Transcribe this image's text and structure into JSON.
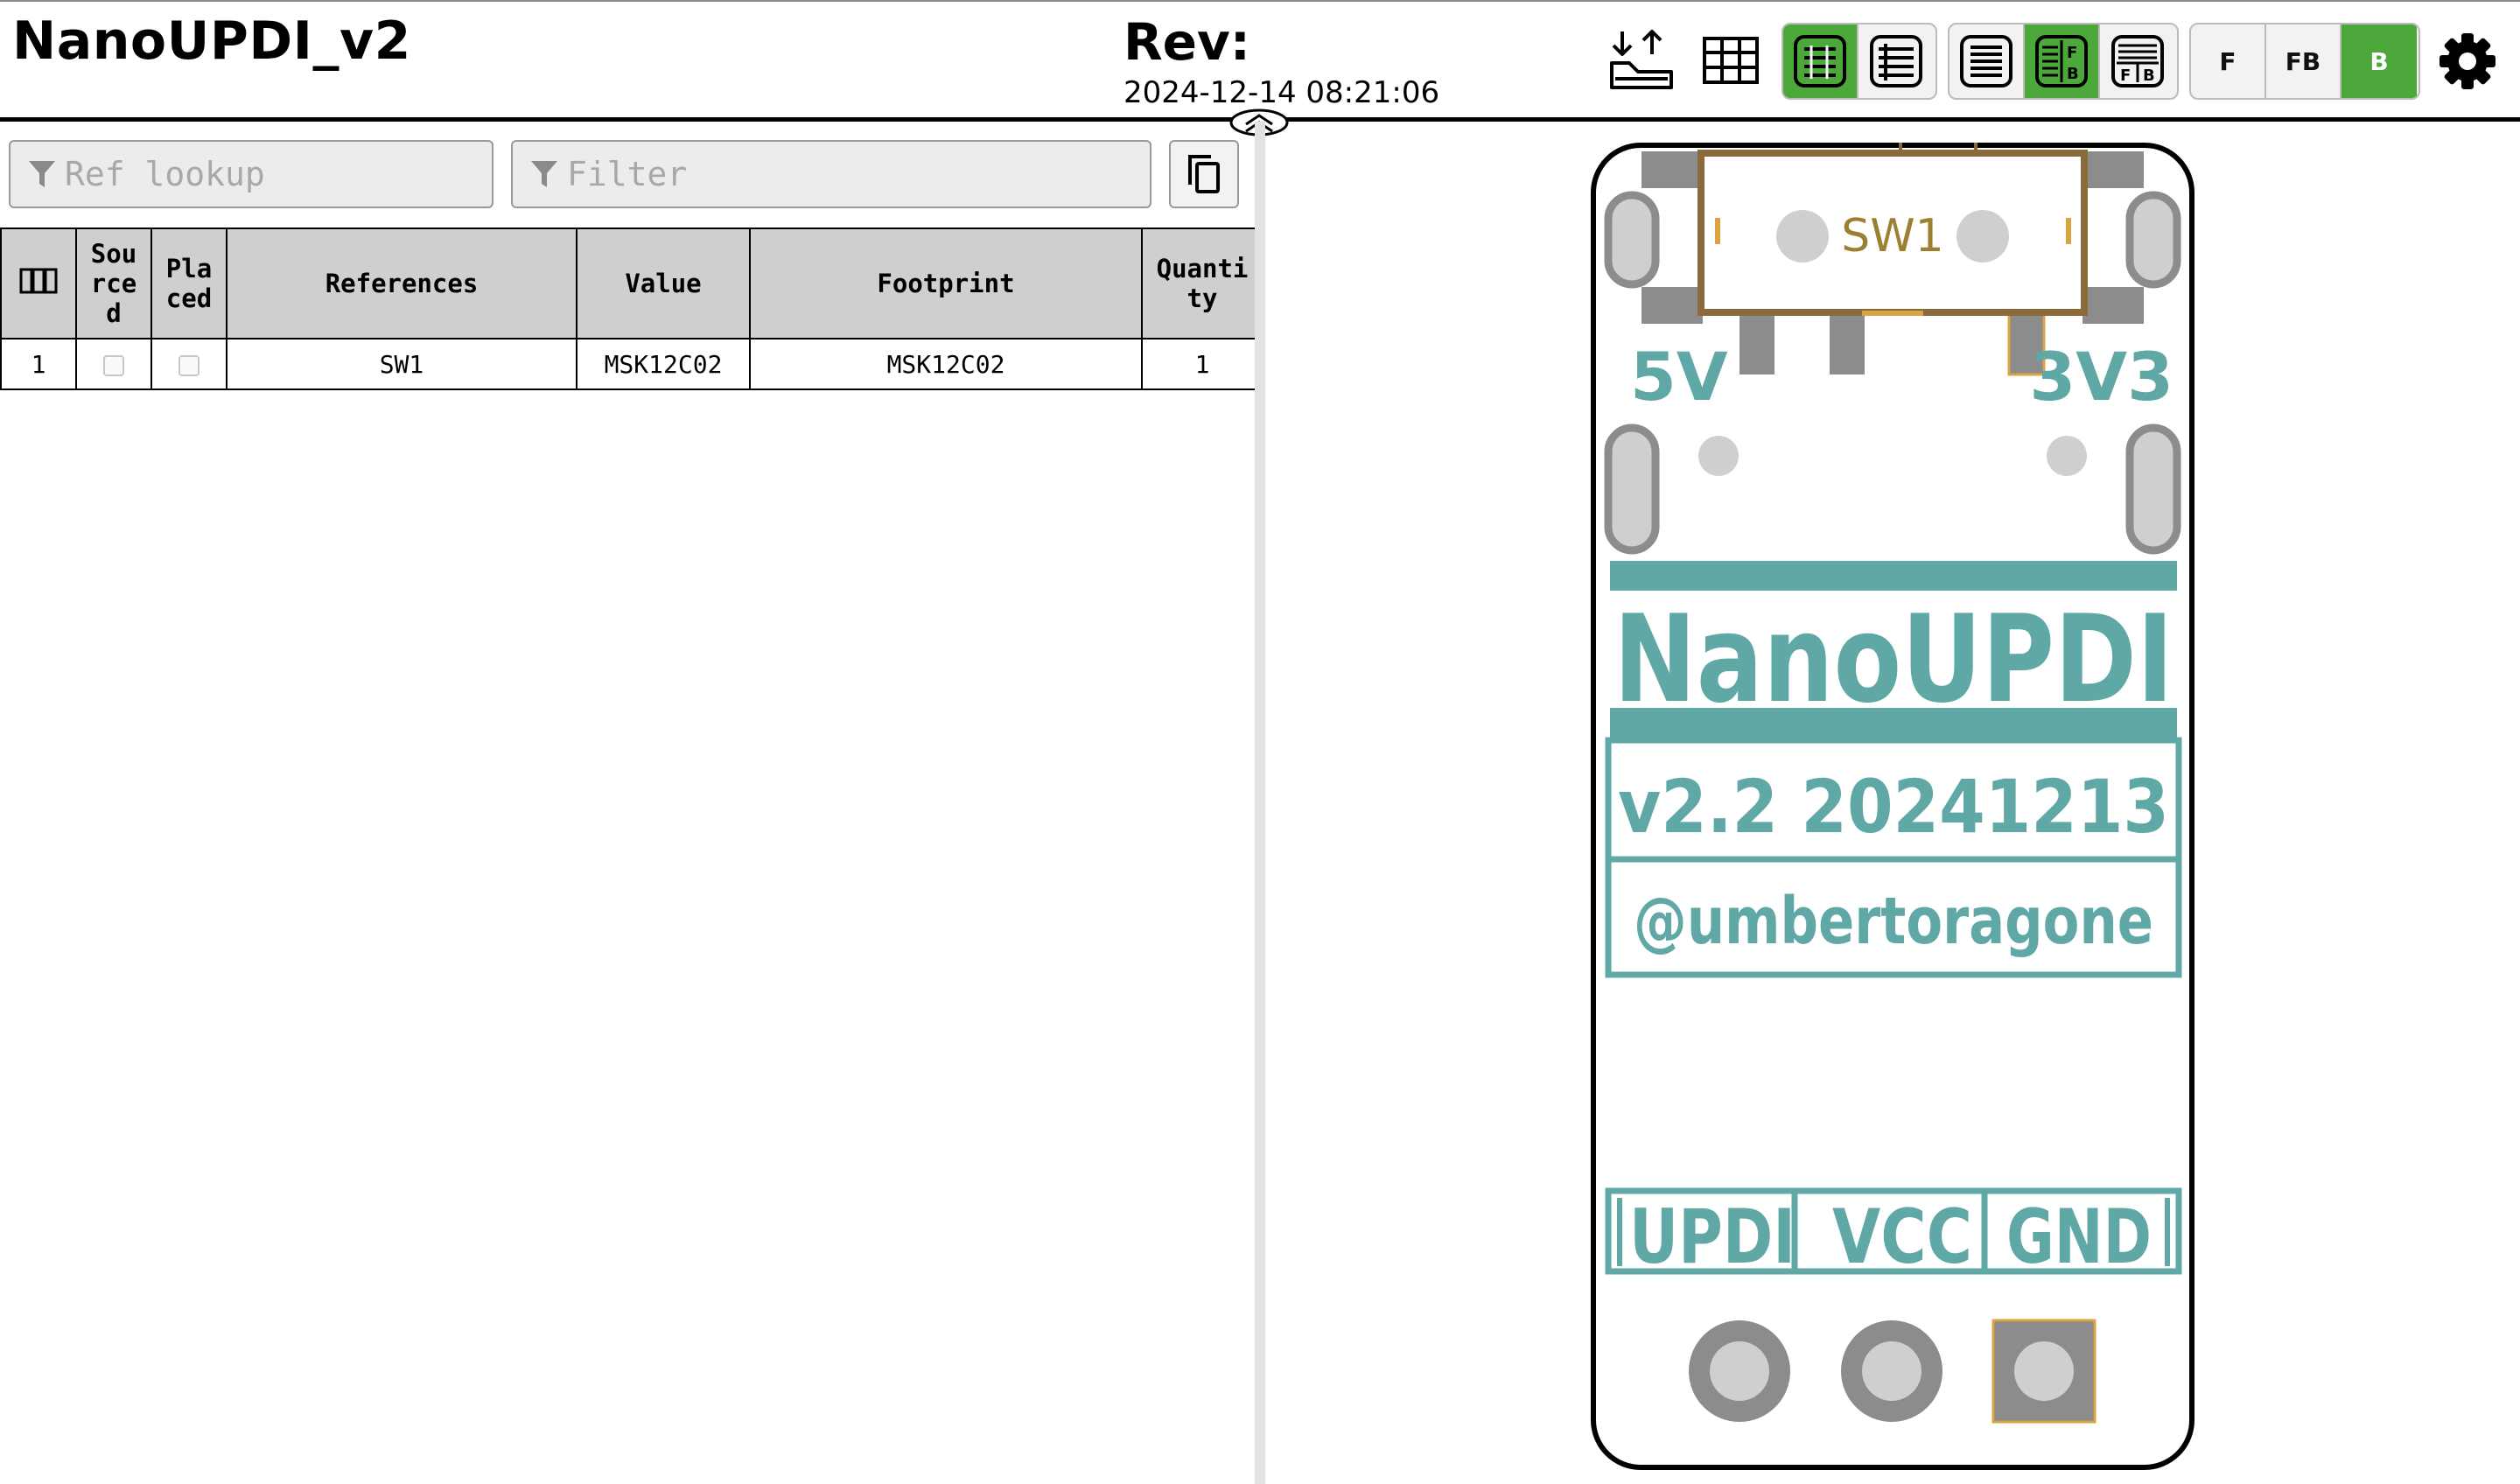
{
  "header": {
    "title": "NanoUPDI_v2",
    "rev_label": "Rev:",
    "rev_date": "2024-12-14 08:21:06",
    "layer_buttons": [
      "F",
      "FB",
      "B"
    ],
    "active_layer": "B"
  },
  "toolbar_icons": [
    "export-icon",
    "grid-icon",
    "bom-only-icon",
    "bom-left-right-icon",
    "bom-left-right-only-icon",
    "bom-fb-split-icon",
    "bom-fb-stacked-icon",
    "settings-icon"
  ],
  "filters": {
    "ref_lookup_placeholder": "Ref lookup",
    "filter_placeholder": "Filter"
  },
  "bom_table": {
    "columns": [
      "Sou\nrce\nd",
      "Pla\nced",
      "References",
      "Value",
      "Footprint",
      "Quanti\nty"
    ],
    "rows": [
      {
        "index": "1",
        "sourced": false,
        "placed": false,
        "references": "SW1",
        "value": "MSK12C02",
        "footprint": "MSK12C02",
        "quantity": "1"
      }
    ]
  },
  "pcb": {
    "switch_label": "SW1",
    "label_5v": "5V",
    "label_3v3": "3V3",
    "logo": "NanoUPDI",
    "version": "v2.2 20241213",
    "author": "@umbertoragone",
    "pin_updi": "UPDI",
    "pin_vcc": "VCC",
    "pin_gnd": "GND",
    "colors": {
      "silkscreen": "#5fa8a6",
      "pad": "#8c8c8c",
      "highlight": "#d9a441",
      "part_outline": "#8a6a3b",
      "part_label": "#9a8030",
      "active_green": "#4da83b"
    }
  }
}
